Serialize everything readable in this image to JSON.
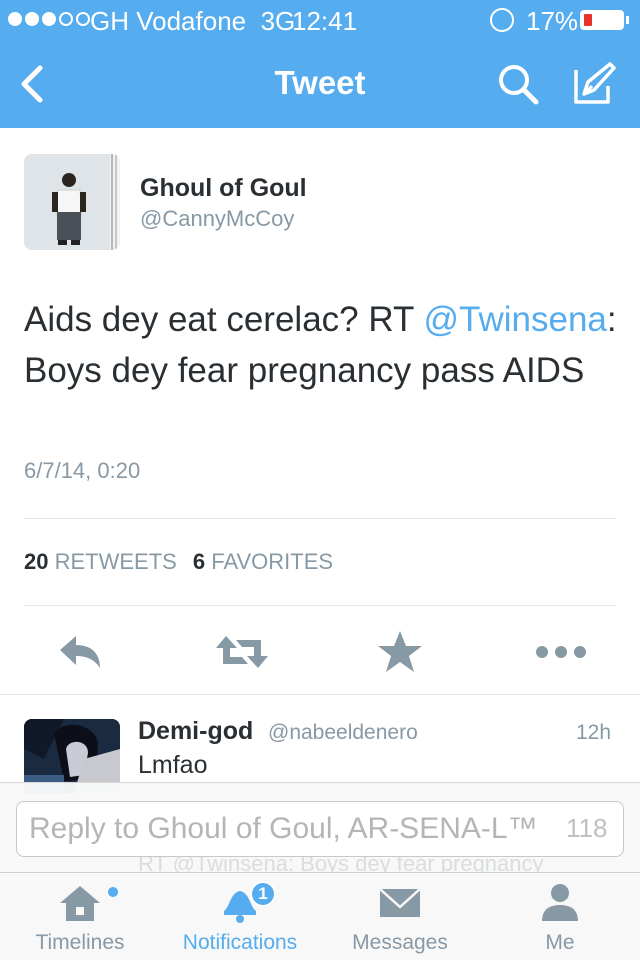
{
  "status_bar": {
    "carrier": "GH Vodafone",
    "network": "3G",
    "time": "12:41",
    "battery": "17%",
    "battery_level": 0.17,
    "signal_bars_filled": 3,
    "signal_bars_total": 5
  },
  "nav": {
    "title": "Tweet"
  },
  "tweet": {
    "author_name": "Ghoul of Goul",
    "author_handle": "@CannyMcCoy",
    "text_part1": "Aids dey eat cerelac? RT ",
    "mention": "@Twinsena",
    "text_part2": ": Boys dey fear pregnancy pass AIDS",
    "timestamp": "6/7/14, 0:20",
    "retweets_count": "20",
    "retweets_label": "RETWEETS",
    "favorites_count": "6",
    "favorites_label": "FAVORITES"
  },
  "reply": {
    "author_name": "Demi-god",
    "author_handle": "@nabeeldenero",
    "time": "12h",
    "text": "Lmfao",
    "ghost_text": "RT @Twinsena: Boys dey fear pregnancy"
  },
  "composer": {
    "placeholder": "Reply to Ghoul of Goul, AR-SENA-L™",
    "char_count": "118"
  },
  "tabs": [
    {
      "label": "Timelines",
      "icon": "home-icon"
    },
    {
      "label": "Notifications",
      "icon": "bell-icon",
      "badge": "1"
    },
    {
      "label": "Messages",
      "icon": "envelope-icon"
    },
    {
      "label": "Me",
      "icon": "person-icon"
    }
  ],
  "colors": {
    "brand": "#55acee",
    "text": "#292f33",
    "muted": "#8899a6",
    "battery_low": "#e8332b"
  }
}
